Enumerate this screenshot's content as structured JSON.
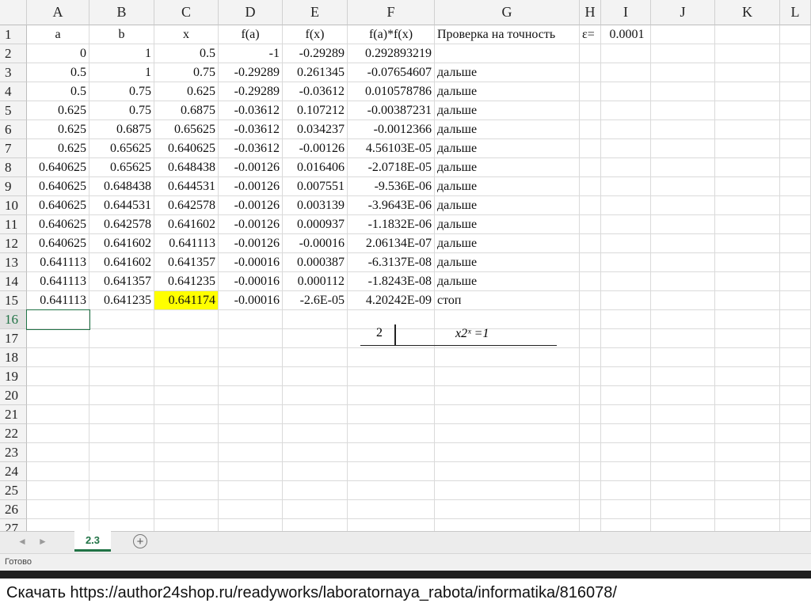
{
  "columns": [
    "A",
    "B",
    "C",
    "D",
    "E",
    "F",
    "G",
    "H",
    "I",
    "J",
    "K",
    "L"
  ],
  "rows": [
    "1",
    "2",
    "3",
    "4",
    "5",
    "6",
    "7",
    "8",
    "9",
    "10",
    "11",
    "12",
    "13",
    "14",
    "15",
    "16",
    "17",
    "18",
    "19",
    "20",
    "21",
    "22",
    "23",
    "24",
    "25",
    "26",
    "27"
  ],
  "cells": [
    [
      "a",
      "b",
      "x",
      "f(a)",
      "f(x)",
      "f(a)*f(x)",
      "Проверка на точность",
      "ε=",
      "0.0001",
      "",
      ""
    ],
    [
      "0",
      "1",
      "0.5",
      "-1",
      "-0.29289",
      "0.292893219",
      "",
      "",
      "",
      "",
      ""
    ],
    [
      "0.5",
      "1",
      "0.75",
      "-0.29289",
      "0.261345",
      "-0.07654607",
      "дальше",
      "",
      "",
      "",
      ""
    ],
    [
      "0.5",
      "0.75",
      "0.625",
      "-0.29289",
      "-0.03612",
      "0.010578786",
      "дальше",
      "",
      "",
      "",
      ""
    ],
    [
      "0.625",
      "0.75",
      "0.6875",
      "-0.03612",
      "0.107212",
      "-0.00387231",
      "дальше",
      "",
      "",
      "",
      ""
    ],
    [
      "0.625",
      "0.6875",
      "0.65625",
      "-0.03612",
      "0.034237",
      "-0.0012366",
      "дальше",
      "",
      "",
      "",
      ""
    ],
    [
      "0.625",
      "0.65625",
      "0.640625",
      "-0.03612",
      "-0.00126",
      "4.56103E-05",
      "дальше",
      "",
      "",
      "",
      ""
    ],
    [
      "0.640625",
      "0.65625",
      "0.648438",
      "-0.00126",
      "0.016406",
      "-2.0718E-05",
      "дальше",
      "",
      "",
      "",
      ""
    ],
    [
      "0.640625",
      "0.648438",
      "0.644531",
      "-0.00126",
      "0.007551",
      "-9.536E-06",
      "дальше",
      "",
      "",
      "",
      ""
    ],
    [
      "0.640625",
      "0.644531",
      "0.642578",
      "-0.00126",
      "0.003139",
      "-3.9643E-06",
      "дальше",
      "",
      "",
      "",
      ""
    ],
    [
      "0.640625",
      "0.642578",
      "0.641602",
      "-0.00126",
      "0.000937",
      "-1.1832E-06",
      "дальше",
      "",
      "",
      "",
      ""
    ],
    [
      "0.640625",
      "0.641602",
      "0.641113",
      "-0.00126",
      "-0.00016",
      "2.06134E-07",
      "дальше",
      "",
      "",
      "",
      ""
    ],
    [
      "0.641113",
      "0.641602",
      "0.641357",
      "-0.00016",
      "0.000387",
      "-6.3137E-08",
      "дальше",
      "",
      "",
      "",
      ""
    ],
    [
      "0.641113",
      "0.641357",
      "0.641235",
      "-0.00016",
      "0.000112",
      "-1.8243E-08",
      "дальше",
      "",
      "",
      "",
      ""
    ],
    [
      "0.641113",
      "0.641235",
      "0.641174",
      "-0.00016",
      "-2.6E-05",
      "4.20242E-09",
      "стоп",
      "",
      "",
      "",
      ""
    ]
  ],
  "highlight_cell": {
    "row": "15",
    "column": "C",
    "color": "#ffff00"
  },
  "active_row": "16",
  "accent_color": "#217346",
  "formula_image": {
    "left": "2",
    "right": "x2ˣ =1"
  },
  "sheet_tab": "2.3",
  "add_sheet_icon": "+",
  "nav_icons": [
    "◄",
    "►"
  ],
  "status": "Готово",
  "footer": "Скачать https://author24shop.ru/readyworks/laboratornaya_rabota/informatika/816078/"
}
